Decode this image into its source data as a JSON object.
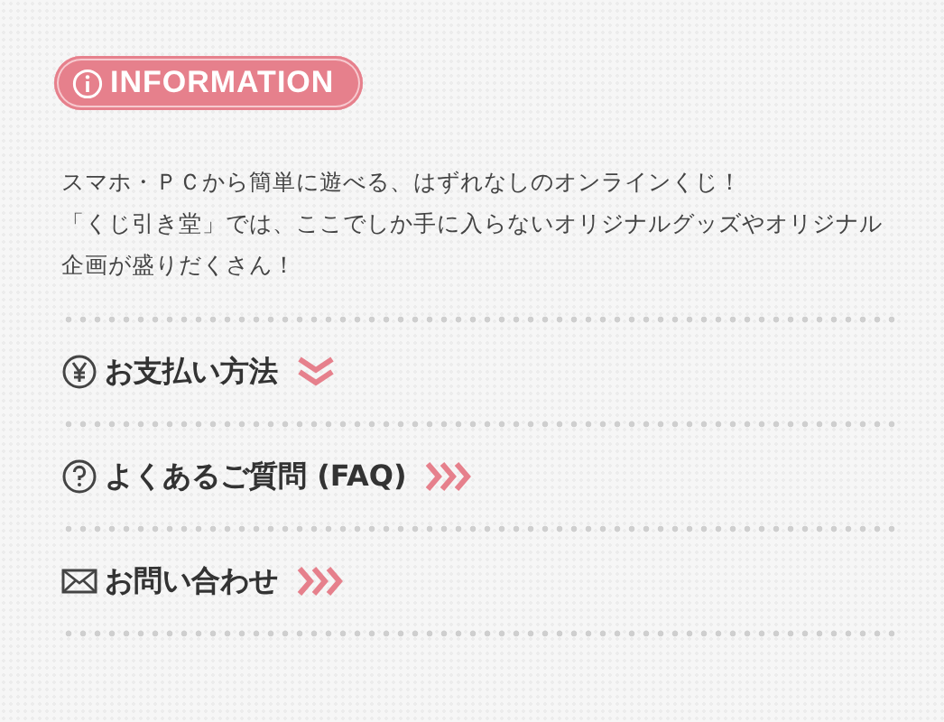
{
  "badge": {
    "label": "INFORMATION"
  },
  "intro": [
    "スマホ・ＰＣから簡単に遊べる、はずれなしのオンラインくじ！",
    "「くじ引き堂」では、ここでしか手に入らないオリジナルグッズやオリジナル企画が盛りだくさん！"
  ],
  "links": [
    {
      "label": "お支払い方法",
      "kind": "accordion"
    },
    {
      "label": "よくあるご質問 (FAQ)",
      "kind": "link"
    },
    {
      "label": "お問い合わせ",
      "kind": "link"
    }
  ]
}
